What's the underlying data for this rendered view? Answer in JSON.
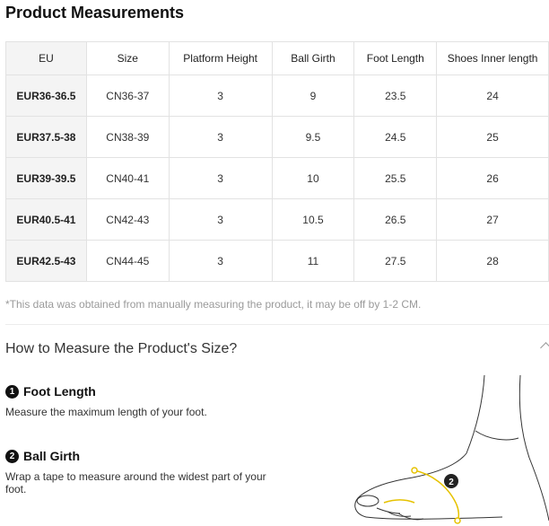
{
  "title": "Product Measurements",
  "table": {
    "headers": [
      "EU",
      "Size",
      "Platform Height",
      "Ball Girth",
      "Foot Length",
      "Shoes Inner length"
    ],
    "rows": [
      [
        "EUR36-36.5",
        "CN36-37",
        "3",
        "9",
        "23.5",
        "24"
      ],
      [
        "EUR37.5-38",
        "CN38-39",
        "3",
        "9.5",
        "24.5",
        "25"
      ],
      [
        "EUR39-39.5",
        "CN40-41",
        "3",
        "10",
        "25.5",
        "26"
      ],
      [
        "EUR40.5-41",
        "CN42-43",
        "3",
        "10.5",
        "26.5",
        "27"
      ],
      [
        "EUR42.5-43",
        "CN44-45",
        "3",
        "11",
        "27.5",
        "28"
      ]
    ]
  },
  "note": "*This data was obtained from manually measuring the product, it may be off by 1-2 CM.",
  "howto": {
    "title": "How to Measure the Product's Size?",
    "steps": [
      {
        "num": "1",
        "title": "Foot Length",
        "desc": "Measure the maximum length of your foot."
      },
      {
        "num": "2",
        "title": "Ball Girth",
        "desc": "Wrap a tape to measure around the widest part of your foot."
      }
    ],
    "marker": "2"
  },
  "colors": {
    "accent": "#e6c200",
    "header_bg": "#f4f4f4",
    "border": "#e2e2e2",
    "note": "#9a9a9a"
  }
}
